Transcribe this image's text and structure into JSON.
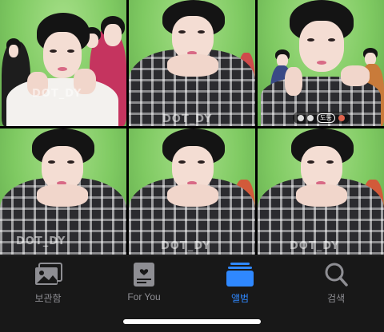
{
  "photos": [
    {
      "watermark": "DOT_DY",
      "kind": "group-heart"
    },
    {
      "watermark": "DOT_DY",
      "kind": "hands-chin"
    },
    {
      "watermark": "",
      "kind": "finger-cheeks",
      "overlay": {
        "badge": "도통"
      }
    },
    {
      "watermark": "DOT_DY",
      "kind": "hands-chin"
    },
    {
      "watermark": "DOT_DY",
      "kind": "hands-chin"
    },
    {
      "watermark": "DOT_DY",
      "kind": "hands-chin"
    }
  ],
  "tabbar": {
    "tabs": [
      {
        "label": "보관함",
        "icon": "photo-library-icon",
        "active": false
      },
      {
        "label": "For You",
        "icon": "for-you-icon",
        "active": false
      },
      {
        "label": "앨범",
        "icon": "albums-icon",
        "active": true
      },
      {
        "label": "검색",
        "icon": "search-icon",
        "active": false
      }
    ]
  },
  "colors": {
    "accent": "#2f88ff",
    "inactive": "#8e8e93",
    "tabbar_bg": "#181818",
    "screen_bg": "#7fca62"
  }
}
